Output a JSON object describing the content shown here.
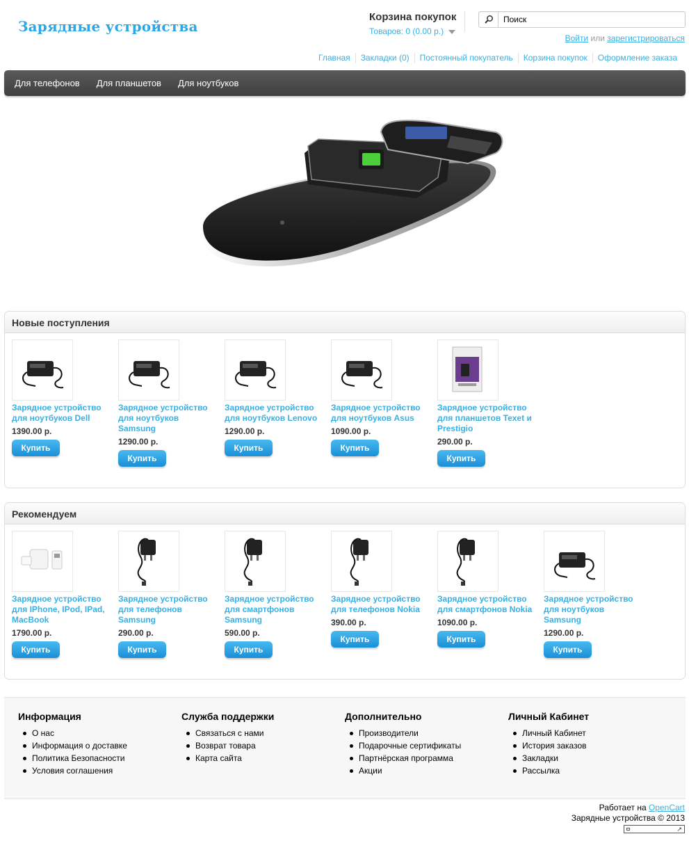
{
  "header": {
    "logo": "Зарядные устройства",
    "cart_title": "Корзина покупок",
    "cart_total": "Товаров: 0 (0.00 р.)",
    "search_placeholder": "Поиск",
    "login": "Войти",
    "login_or": " или ",
    "register": "зарегистрироваться",
    "links": [
      "Главная",
      "Закладки (0)",
      "Постоянный покупатель",
      "Корзина покупок",
      "Оформление заказа"
    ]
  },
  "menu": [
    "Для телефонов",
    "Для планшетов",
    "Для ноутбуков"
  ],
  "latest": {
    "heading": "Новые поступления",
    "products": [
      {
        "name": "Зарядное устройство для ноутбуков Dell",
        "price": "1390.00 р.",
        "buy": "Купить",
        "icon": "laptop-charger-icon"
      },
      {
        "name": "Зарядное устройство для ноутбуков Samsung",
        "price": "1290.00 р.",
        "buy": "Купить",
        "icon": "laptop-charger-icon"
      },
      {
        "name": "Зарядное устройство для ноутбуков Lenovo",
        "price": "1290.00 р.",
        "buy": "Купить",
        "icon": "laptop-charger-icon"
      },
      {
        "name": "Зарядное устройство для ноутбуков Asus",
        "price": "1090.00 р.",
        "buy": "Купить",
        "icon": "laptop-charger-icon"
      },
      {
        "name": "Зарядное устройство для планшетов Texet и Prestigio",
        "price": "290.00 р.",
        "buy": "Купить",
        "icon": "tablet-charger-package-icon"
      }
    ]
  },
  "featured": {
    "heading": "Рекомендуем",
    "products": [
      {
        "name": "Зарядное устройство для IPhone, IPod, IPad, MacBook",
        "price": "1790.00 р.",
        "buy": "Купить",
        "icon": "apple-adapter-icon"
      },
      {
        "name": "Зарядное устройство для телефонов Samsung",
        "price": "290.00 р.",
        "buy": "Купить",
        "icon": "phone-charger-icon"
      },
      {
        "name": "Зарядное устройство для смартфонов Samsung",
        "price": "590.00 р.",
        "buy": "Купить",
        "icon": "phone-charger-icon"
      },
      {
        "name": "Зарядное устройство для телефонов Nokia",
        "price": "390.00 р.",
        "buy": "Купить",
        "icon": "phone-charger-icon"
      },
      {
        "name": "Зарядное устройство для смартфонов Nokia",
        "price": "1090.00 р.",
        "buy": "Купить",
        "icon": "phone-charger-icon"
      },
      {
        "name": "Зарядное устройство для ноутбуков Samsung",
        "price": "1290.00 р.",
        "buy": "Купить",
        "icon": "laptop-charger-icon"
      }
    ]
  },
  "footer": {
    "columns": [
      {
        "title": "Информация",
        "items": [
          "О нас",
          "Информация о доставке",
          "Политика Безопасности",
          "Условия соглашения"
        ]
      },
      {
        "title": "Служба поддержки",
        "items": [
          "Связаться с нами",
          "Возврат товара",
          "Карта сайта"
        ]
      },
      {
        "title": "Дополнительно",
        "items": [
          "Производители",
          "Подарочные сертификаты",
          "Партнёрская программа",
          "Акции"
        ]
      },
      {
        "title": "Личный Кабинет",
        "items": [
          "Личный Кабинет",
          "История заказов",
          "Закладки",
          "Рассылка"
        ]
      }
    ],
    "powered_prefix": "Работает на ",
    "powered_link": "OpenCart",
    "copyright": "Зарядные устройства © 2013"
  },
  "colors": {
    "accent": "#38b0e3",
    "menu": "#4a4a4a",
    "button": "#2a9fe0"
  }
}
